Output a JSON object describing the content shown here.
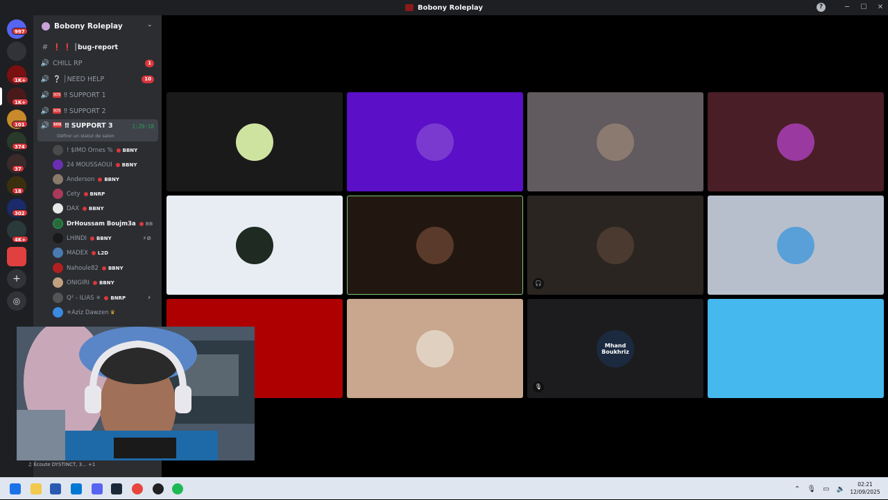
{
  "window": {
    "title": "Bobony Roleplay"
  },
  "rail": {
    "badges": [
      "997",
      "1K+",
      "1K+",
      "101",
      "374",
      "37",
      "18",
      "302",
      "4K+"
    ]
  },
  "server": {
    "name": "Bobony Roleplay"
  },
  "channels": [
    {
      "icon": "#",
      "name": "❗ ❗ │bug-report",
      "count": ""
    },
    {
      "icon": "🔊",
      "name": "CHILL RP",
      "count": "1"
    },
    {
      "icon": "🔊",
      "name": "❔ │NEED HELP",
      "count": "10"
    },
    {
      "icon": "🔊",
      "name": "‼ SUPPORT 1",
      "count": "",
      "sos": "SOS"
    },
    {
      "icon": "🔊",
      "name": "‼ SUPPORT 2",
      "count": "",
      "sos": "SOS"
    }
  ],
  "active_channel": {
    "name": "‼ SUPPORT 3",
    "sos": "SOS",
    "timer": "1:29:18",
    "status": "Définir un statut de salon"
  },
  "voice_users": [
    {
      "name": "! $IMO Ornes %",
      "tag": "BBNY",
      "color": "#4a4a4a"
    },
    {
      "name": "24 MOUSSAOUI",
      "tag": "BBNY",
      "color": "#6a2fb0"
    },
    {
      "name": "Anderson",
      "tag": "BBNY",
      "color": "#8a7a6a"
    },
    {
      "name": "Cety",
      "tag": "BNRP",
      "color": "#a83a5a"
    },
    {
      "name": "DAX",
      "tag": "BBNY",
      "color": "#e8e8e8"
    },
    {
      "name": "DrHoussam Boujm3a",
      "tag": "BB",
      "color": "#2a6a3a"
    },
    {
      "name": "LHINDI",
      "tag": "BBNY",
      "color": "#1a1a1a"
    },
    {
      "name": "MADEX",
      "tag": "L2D",
      "color": "#4a7ab0"
    },
    {
      "name": "Nahoule82",
      "tag": "BBNY",
      "color": "#b02020"
    },
    {
      "name": "ONIGIRI",
      "tag": "BBNY",
      "color": "#c0a080"
    },
    {
      "name": "Q² - ILIAS ✳",
      "tag": "BNRP",
      "color": "#555"
    },
    {
      "name": "✳Aziz Dawzen ",
      "tag": "",
      "color": "#3a8ae0"
    }
  ],
  "tiles": [
    {
      "bg": "#1a1a1a",
      "av": "#cfe3a0",
      "mic": ""
    },
    {
      "bg": "#5b0fc7",
      "av": "#7a3ad0",
      "mic": ""
    },
    {
      "bg": "#615a5e",
      "av": "#8a7a70",
      "mic": ""
    },
    {
      "bg": "#4a1e26",
      "av": "#9a3aa0",
      "mic": ""
    },
    {
      "bg": "#e8edf3",
      "av": "#1e2a22",
      "mic": ""
    },
    {
      "bg": "#221710",
      "av": "#5a3a2a",
      "mic": ""
    },
    {
      "bg": "#2a2521",
      "av": "#4a3a30",
      "mic": "🎧"
    },
    {
      "bg": "#b8bfcc",
      "av": "#5aa0d8",
      "mic": ""
    },
    {
      "bg": "#ae0000",
      "av": "#ae0000",
      "mic": ""
    },
    {
      "bg": "#c9a68e",
      "av": "#e0d0c0",
      "mic": ""
    },
    {
      "bg": "#1c1c1f",
      "av": "#1c2a40",
      "mic": "🎙"
    },
    {
      "bg": "#45b8ed",
      "av": "#45b8ed",
      "mic": ""
    }
  ],
  "tile_labels": {
    "t11": "Mhand Boukhriz"
  },
  "userbar": {
    "listening": "♫ Écoute DYSTINCT, 3... +1"
  },
  "clock": {
    "time": "02:21",
    "date": "12/09/2025"
  }
}
